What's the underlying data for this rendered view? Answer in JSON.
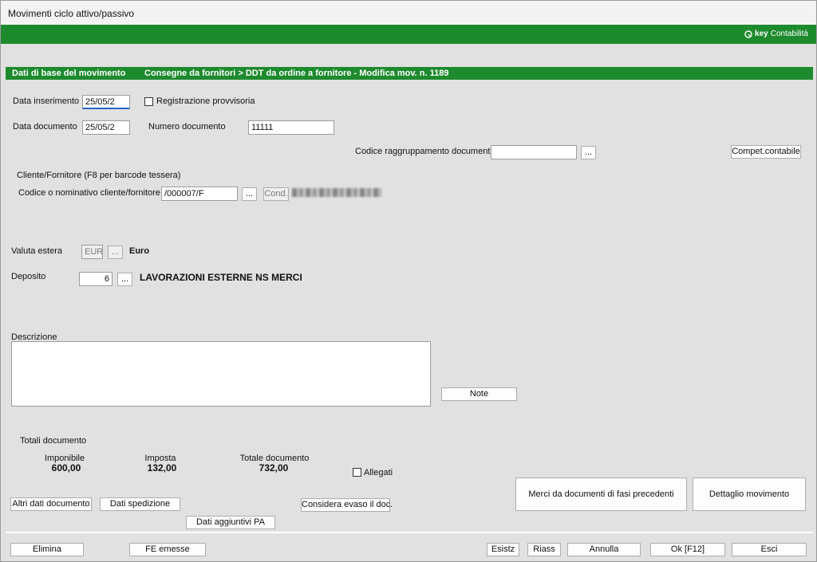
{
  "window": {
    "title": "Movimenti ciclo attivo/passivo"
  },
  "brand": {
    "key": "key",
    "name": "Contabilità"
  },
  "header": {
    "section": "Dati di base del  movimento",
    "path": "Consegne da fornitori > DDT da ordine a fornitore - Modifica mov. n. 1189"
  },
  "form": {
    "data_inserimento_label": "Data inserimento",
    "data_inserimento_value": "25/05/2",
    "registrazione_provvisoria_label": "Registrazione provvisoria",
    "data_documento_label": "Data documento",
    "data_documento_value": "25/05/2",
    "numero_documento_label": "Numero documento",
    "numero_documento_value": "11111",
    "codice_raggruppamento_label": "Codice raggruppamento documenti",
    "codice_raggruppamento_value": "",
    "browse_label": "...",
    "compet_contabile_label": "Compet.contabile",
    "cliente_section_label": "Cliente/Fornitore (F8 per barcode tessera)",
    "codice_cliente_label": "Codice o nominativo cliente/fornitore",
    "codice_cliente_value": "/000007/F",
    "cond_label": "Cond.",
    "valuta_label": "Valuta estera",
    "valuta_value": "EUR",
    "valuta_name": "Euro",
    "deposito_label": "Deposito",
    "deposito_value": "6",
    "deposito_name": "LAVORAZIONI ESTERNE NS MERCI",
    "descrizione_label": "Descrizione",
    "note_label": "Note"
  },
  "totals": {
    "section_label": "Totali documento",
    "imponibile_label": "Imponibile",
    "imponibile_value": "600,00",
    "imposta_label": "Imposta",
    "imposta_value": "132,00",
    "totale_label": "Totale documento",
    "totale_value": "732,00",
    "allegati_label": "Allegati"
  },
  "actions": {
    "altri_dati": "Altri dati documento",
    "dati_spedizione": "Dati spedizione",
    "dati_aggiuntivi_pa": "Dati aggiuntivi PA",
    "considera_evaso": "Considera evaso il doc.",
    "merci_da_documenti": "Merci da documenti di fasi precedenti",
    "dettaglio_movimento": "Dettaglio movimento"
  },
  "footer": {
    "elimina": "Elimina",
    "fe_emesse": "FE emesse",
    "esistz": "Esistz",
    "riass": "Riass",
    "annulla": "Annulla",
    "ok": "Ok [F12]",
    "esci": "Esci"
  },
  "colors": {
    "green": "#1e8a2e",
    "panel": "#e1e1e1"
  }
}
